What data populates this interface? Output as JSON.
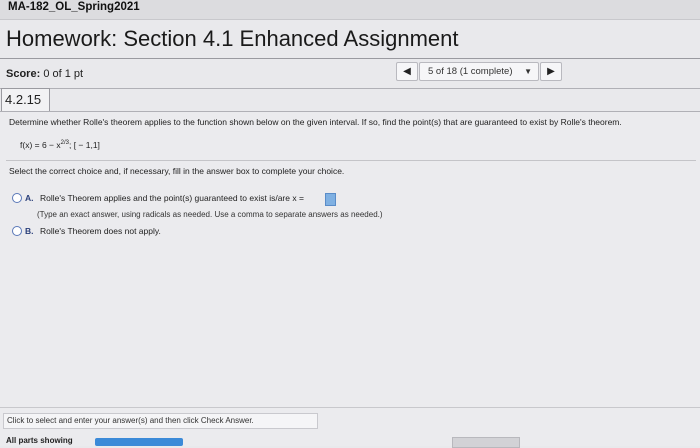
{
  "course": {
    "title": "MA-182_OL_Spring2021"
  },
  "homework": {
    "title": "Homework: Section 4.1 Enhanced Assignment"
  },
  "score": {
    "label": "Score:",
    "value": "0 of 1 pt"
  },
  "navigation": {
    "prev_icon": "◀",
    "question_select": "5 of 18 (1 complete)",
    "select_caret": "▼",
    "next_icon": "▶"
  },
  "question": {
    "number": "4.2.15",
    "statement": "Determine whether Rolle's theorem applies to the function shown below on the given interval. If so, find the point(s) that are guaranteed to exist by Rolle's theorem.",
    "function_prefix": "f(x) = 6 − x",
    "function_exponent": "2/3",
    "function_interval": "; [ − 1,1]",
    "instruction": "Select the correct choice and, if necessary, fill in the answer box to complete your choice.",
    "option_a": {
      "letter": "A.",
      "text": "Rolle's Theorem applies and the point(s) guaranteed to exist is/are x =",
      "help": "(Type an exact answer, using radicals as needed. Use a comma to separate answers as needed.)"
    },
    "option_b": {
      "letter": "B.",
      "text": "Rolle's Theorem does not apply."
    }
  },
  "footer": {
    "message": "Click to select and enter your answer(s) and then click Check Answer.",
    "parts_label": "All parts showing"
  }
}
